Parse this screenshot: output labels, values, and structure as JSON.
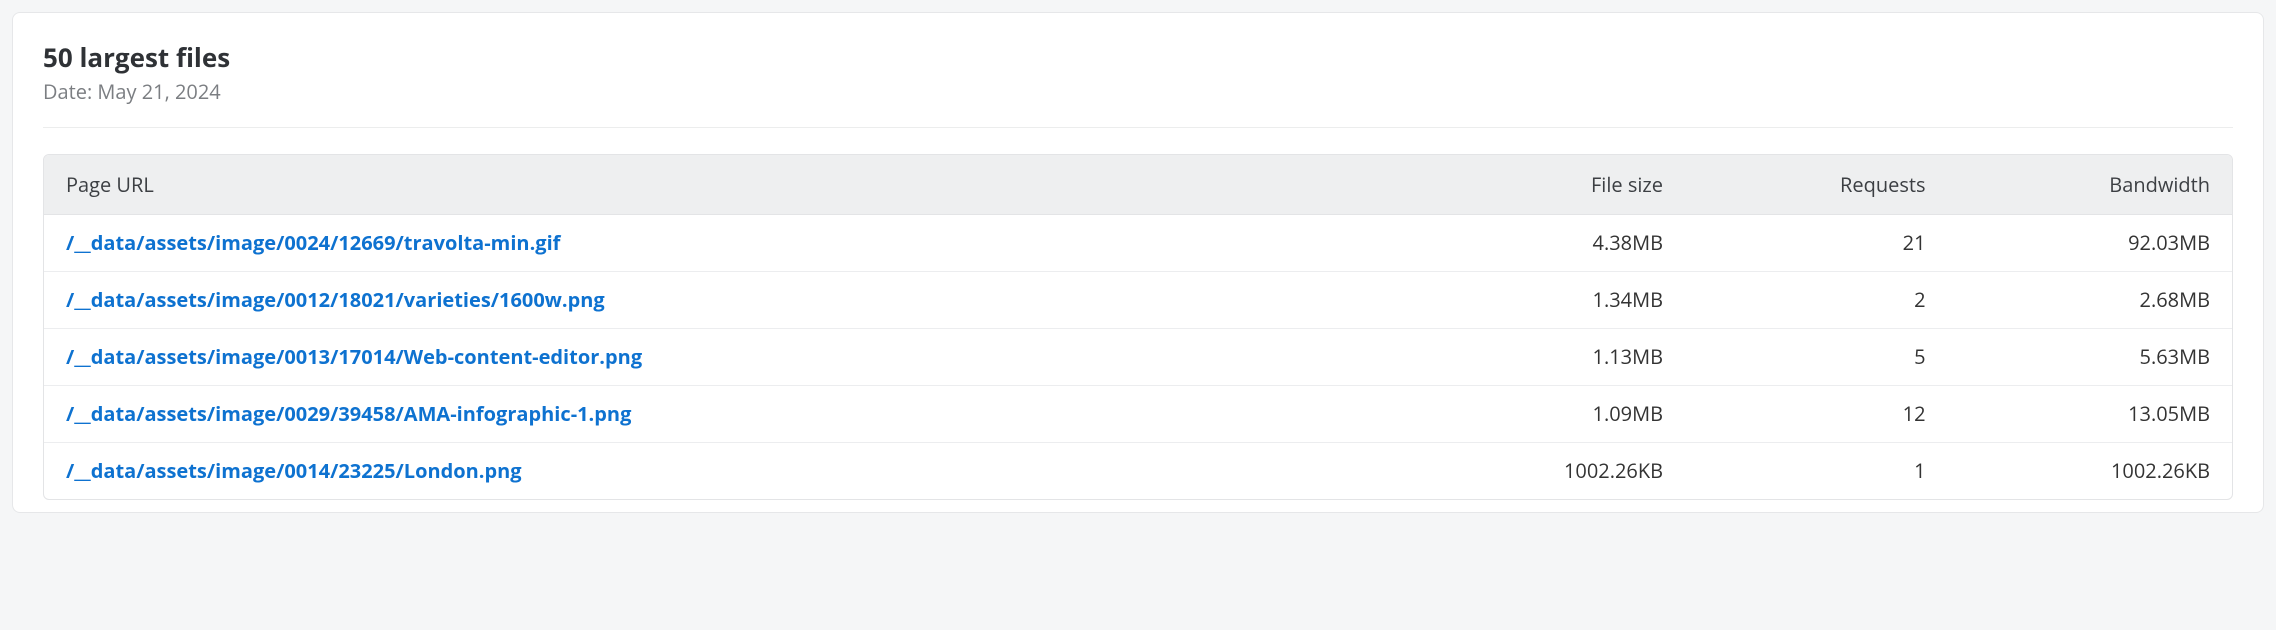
{
  "header": {
    "title": "50 largest files",
    "date_label": "Date: May 21, 2024"
  },
  "table": {
    "columns": {
      "url": "Page URL",
      "size": "File size",
      "requests": "Requests",
      "bandwidth": "Bandwidth"
    },
    "rows": [
      {
        "url": "/__data/assets/image/0024/12669/travolta-min.gif",
        "size": "4.38MB",
        "requests": "21",
        "bandwidth": "92.03MB"
      },
      {
        "url": "/__data/assets/image/0012/18021/varieties/1600w.png",
        "size": "1.34MB",
        "requests": "2",
        "bandwidth": "2.68MB"
      },
      {
        "url": "/__data/assets/image/0013/17014/Web-content-editor.png",
        "size": "1.13MB",
        "requests": "5",
        "bandwidth": "5.63MB"
      },
      {
        "url": "/__data/assets/image/0029/39458/AMA-infographic-1.png",
        "size": "1.09MB",
        "requests": "12",
        "bandwidth": "13.05MB"
      },
      {
        "url": "/__data/assets/image/0014/23225/London.png",
        "size": "1002.26KB",
        "requests": "1",
        "bandwidth": "1002.26KB"
      }
    ]
  }
}
